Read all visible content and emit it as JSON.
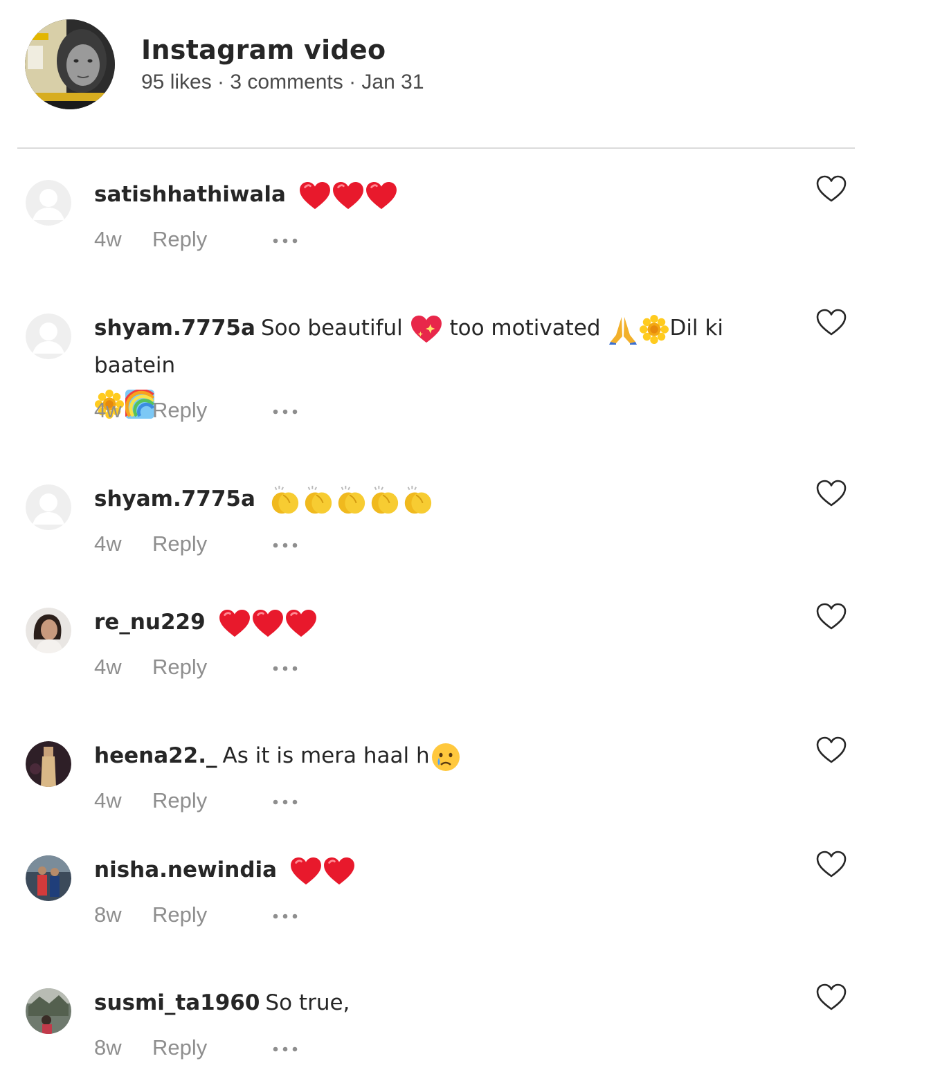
{
  "post": {
    "title": "Instagram video",
    "meta": "95 likes · 3 comments · Jan 31"
  },
  "icons": {
    "like": "heart-outline-icon",
    "more": "ellipsis-icon"
  },
  "colors": {
    "text": "#262626",
    "secondary": "#8e8e8e",
    "divider": "#dbdbdb",
    "heart_emoji": "#e8192c"
  },
  "comments": [
    {
      "username": "satishhathiwala",
      "text": "",
      "emojis": [
        "red-heart",
        "red-heart",
        "red-heart"
      ],
      "time": "4w",
      "reply": "Reply"
    },
    {
      "username": "shyam.7775a",
      "text_1": "Soo beautiful",
      "emoji_1": "sparkling-heart",
      "text_2": "too motivated",
      "emoji_2": [
        "folded-hands",
        "sunflower"
      ],
      "text_3": "Dil ki baatein",
      "emoji_3": [
        "sunflower",
        "rainbow"
      ],
      "time": "4w",
      "reply": "Reply"
    },
    {
      "username": "shyam.7775a",
      "text": "",
      "emojis": [
        "clapping-hands",
        "clapping-hands",
        "clapping-hands",
        "clapping-hands",
        "clapping-hands"
      ],
      "time": "4w",
      "reply": "Reply"
    },
    {
      "username": "re_nu229",
      "text": "",
      "emojis": [
        "red-heart",
        "red-heart",
        "red-heart"
      ],
      "time": "4w",
      "reply": "Reply"
    },
    {
      "username": "heena22._",
      "text": "As it is mera haal h",
      "emojis": [
        "crying-face"
      ],
      "time": "4w",
      "reply": "Reply"
    },
    {
      "username": "nisha.newindia",
      "text": "",
      "emojis": [
        "red-heart",
        "red-heart"
      ],
      "time": "8w",
      "reply": "Reply"
    },
    {
      "username": "susmi_ta1960",
      "text": "So true,",
      "emojis": [],
      "time": "8w",
      "reply": "Reply"
    }
  ]
}
